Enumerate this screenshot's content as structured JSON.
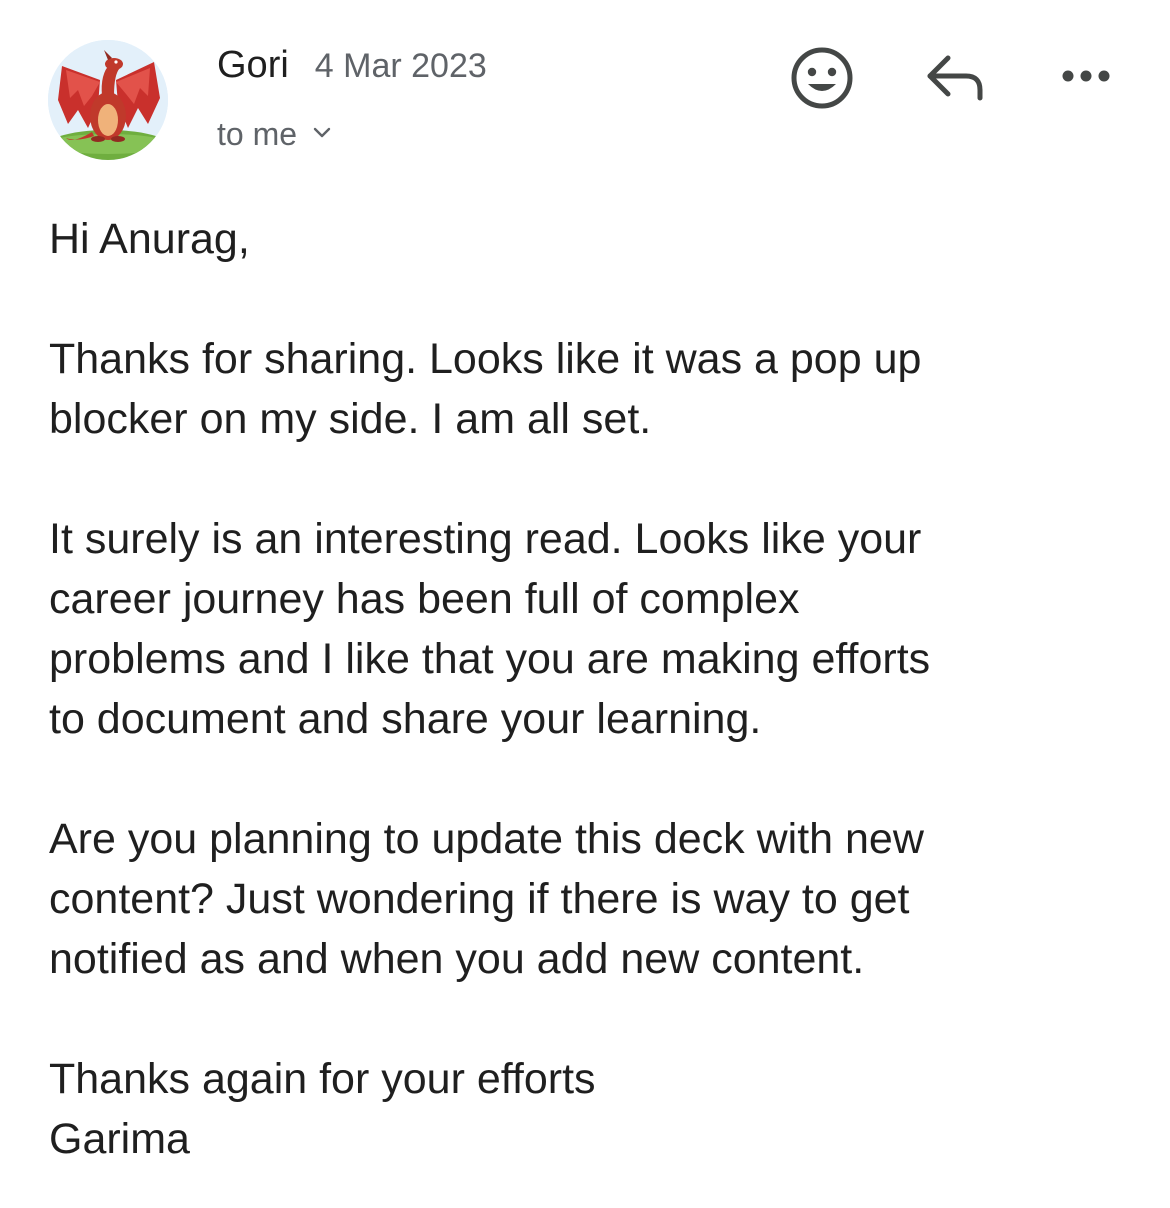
{
  "email": {
    "sender_name": "Gori",
    "date": "4 Mar 2023",
    "recipient_label": "to me",
    "greeting": "Hi Anurag,",
    "paragraph_1_line_1": "Thanks for sharing. Looks like it was a pop up",
    "paragraph_1_line_2": "blocker on my side. I am all set.",
    "paragraph_2_line_1": "It surely is an interesting read. Looks like your",
    "paragraph_2_line_2": "career journey has been full of complex",
    "paragraph_2_line_3": "problems and I like that you are making efforts",
    "paragraph_2_line_4": "to document and share your learning.",
    "paragraph_3_line_1": "Are you planning to update this deck with new",
    "paragraph_3_line_2": "content? Just wondering if there is way to get",
    "paragraph_3_line_3": "notified as and when you add new content.",
    "closing": "Thanks again for your efforts",
    "signature": "Garima"
  },
  "icons": {
    "avatar": "red-dragon-avatar",
    "emoji": "smiley-face-icon",
    "reply": "reply-arrow-icon",
    "more": "more-horizontal-icon",
    "expand": "chevron-down-icon"
  },
  "colors": {
    "text_primary": "#1f1f1f",
    "text_secondary": "#5f6368",
    "icon": "#444746",
    "background": "#ffffff"
  }
}
